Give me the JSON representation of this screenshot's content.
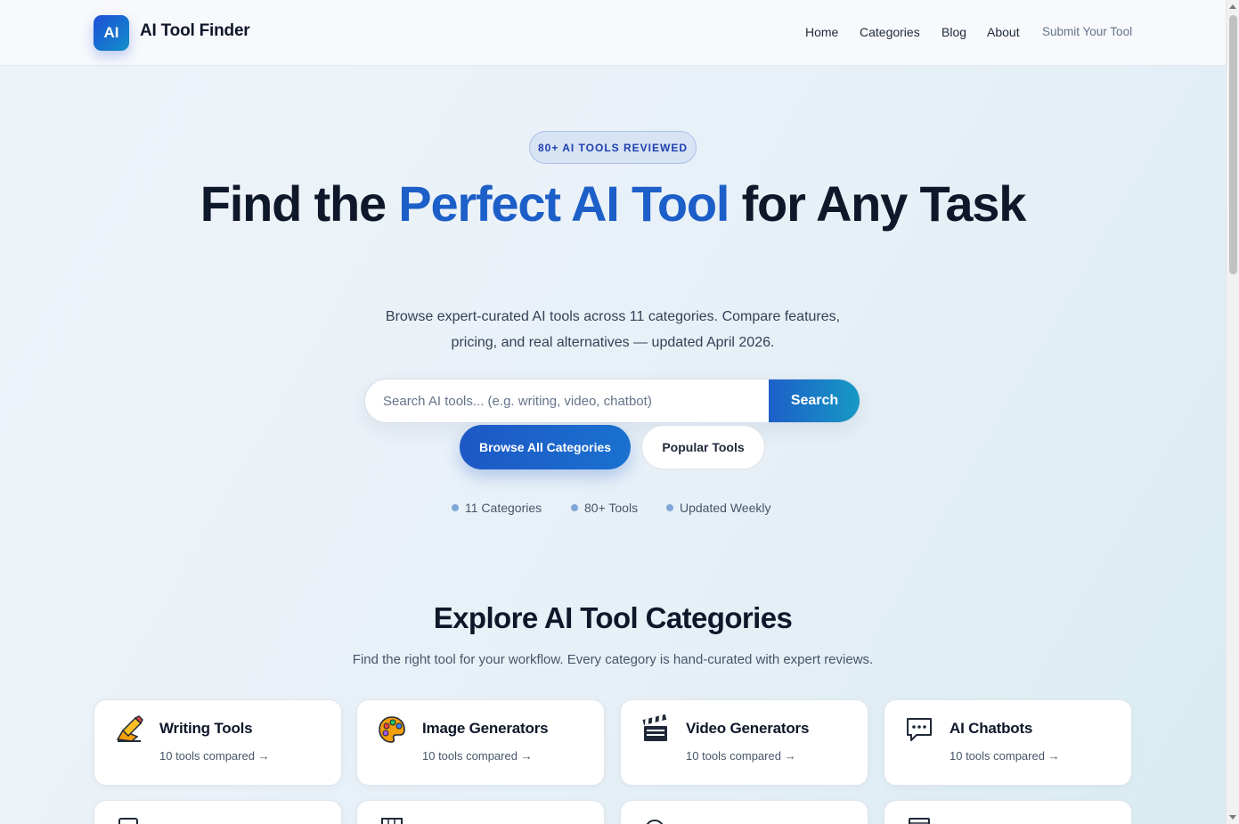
{
  "header": {
    "logo_badge": "AI",
    "logo_text": "AI Tool Finder",
    "nav": {
      "home": "Home",
      "categories": "Categories",
      "blog": "Blog",
      "about": "About",
      "submit": "Submit Your Tool"
    }
  },
  "hero": {
    "pill": "80+ AI TOOLS REVIEWED",
    "title_part1": "Find the ",
    "title_accent": "Perfect AI Tool",
    "title_part2": " for Any Task",
    "subtitle": "Browse expert-curated AI tools across 11 categories. Compare features, pricing, and real alternatives — updated April 2026.",
    "search": {
      "placeholder": "Search AI tools... (e.g. writing, video, chatbot)",
      "value": "",
      "button_label": "Search"
    },
    "primary_button": "Browse All Categories",
    "secondary_button": "Popular Tools",
    "stats": [
      "11 Categories",
      "80+ Tools",
      "Updated Weekly"
    ]
  },
  "categories_section": {
    "title": "Explore AI Tool Categories",
    "subtitle": "Find the right tool for your workflow. Every category is hand-curated with expert reviews.",
    "cards": [
      {
        "title": "Writing Tools",
        "sub": "10 tools compared →",
        "icon": "pencil-icon"
      },
      {
        "title": "Image Generators",
        "sub": "10 tools compared →",
        "icon": "palette-icon"
      },
      {
        "title": "Video Generators",
        "sub": "10 tools compared →",
        "icon": "clapperboard-icon"
      },
      {
        "title": "AI Chatbots",
        "sub": "10 tools compared →",
        "icon": "chat-bubble-icon"
      }
    ]
  },
  "colors": {
    "brand_blue": "#1d5fc8",
    "accent_teal": "#169ac4",
    "text_dark": "#0f172a"
  }
}
